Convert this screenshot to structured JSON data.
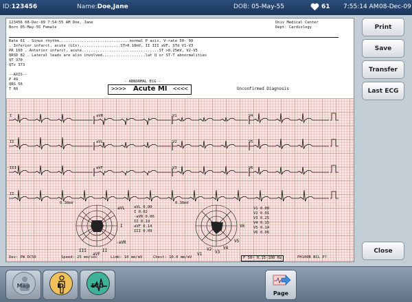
{
  "status_bar": {
    "id_label": "ID:",
    "id_value": "123456",
    "name_label": "Name:",
    "name_value": "Doe,Jane",
    "dob_label": "DOB:",
    "dob_value": "05-May-55",
    "heart_rate": "61",
    "time": "7:55:14 AM",
    "date": "08-Dec-09"
  },
  "report": {
    "header_left": [
      "123456          08-Dec-09    7:54:55 AM  Doe, Jane",
      "Born 05-May-55                           Female"
    ],
    "header_right": [
      "Univ Medical Center",
      "Dept: Cardiology"
    ],
    "statements": [
      "Rate  61   . Sinus rhythm...............................normal P axis, V-rate  50- 99",
      "           . Inferior infarct, acute (LCx)..................ST>0.10mV, II III aVF, STd V1-V3",
      "PR   160   . Anterior infarct, acute..................................ST >0.25mV, V2-V5",
      "QRSD  82   . Lateral leads are also involved...................lat Q or ST-T abnormalities",
      "QT   370",
      "QTc  373",
      "",
      "--AXIS--",
      "P     49",
      "QRS   56",
      "T     60"
    ],
    "abnormal_label": "- ABNORMAL ECG -",
    "dx_prefix": ">>>>",
    "dx_main": "Acute MI",
    "dx_suffix": "<<<<",
    "unconfirmed": "Unconfirmed Diagnosis",
    "leads": [
      "I",
      "aVR",
      "V1",
      "V4",
      "II",
      "aVL",
      "V2",
      "V5",
      "III",
      "aVF",
      "V3",
      "V6",
      "II"
    ],
    "scale_left": "0.30mV",
    "scale_right": "0.30mV",
    "st_table_left": [
      "aVL   0.00",
      "I     0.02",
      "-aVR  0.06",
      "II    0.19",
      "aVF   0.14",
      "III   0.09"
    ],
    "st_table_right": [
      "V1    0.00",
      "V2    0.01",
      "V3    0.25",
      "V4    0.15",
      "V5    0.14",
      "V6    0.06"
    ],
    "footer": {
      "device": "Dev: PW DC50",
      "speed": "Speed: 25 mm/sec",
      "limb": "Limb: 10 mm/mV",
      "chest": "Chest: 10.0 mm/mV",
      "filter": "F 50~ 0.15-100 Hz",
      "model": "PH100B BCL  P?"
    }
  },
  "buttons": {
    "print": "Print",
    "save": "Save",
    "transfer": "Transfer",
    "last_ecg": "Last ECG",
    "close": "Close"
  },
  "nav": {
    "map": "Map",
    "id": "ID",
    "ecg": "ECG",
    "page": "Page"
  },
  "colors": {
    "grid_background": "#fde3e3",
    "grid_major": "#f19a9a",
    "trace": "#111111",
    "status_bar": "#1f3d66",
    "id_button": "#f0c05a",
    "ecg_button": "#3fb39a"
  }
}
